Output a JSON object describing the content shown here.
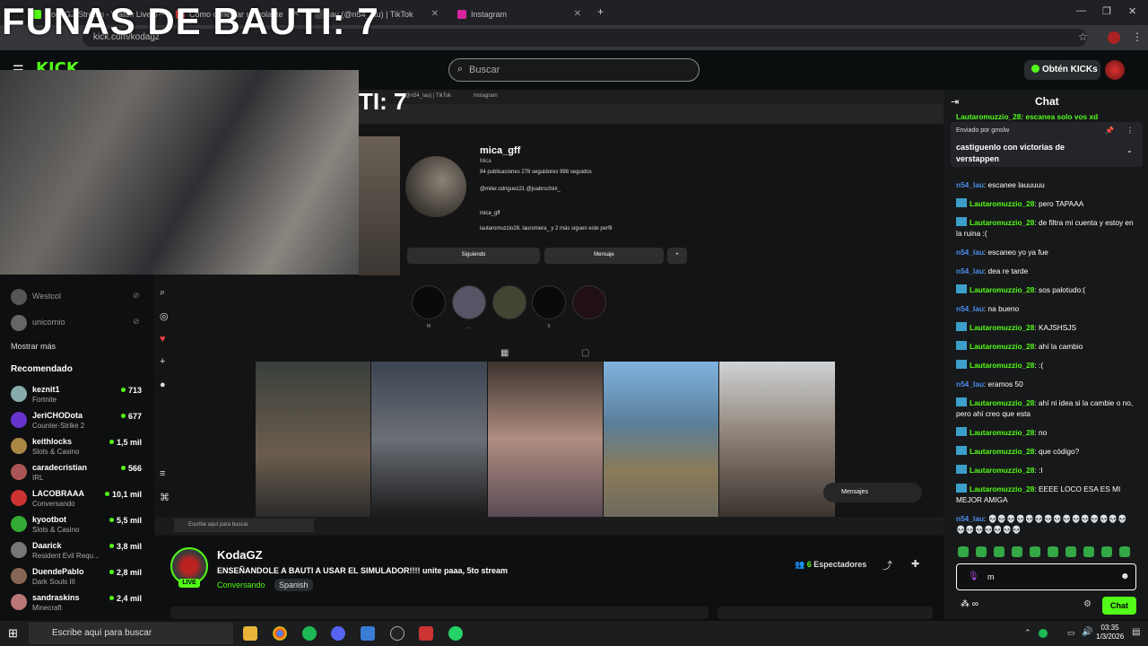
{
  "overlay": {
    "title": "FUNAS DE BAUTI: 7"
  },
  "browser": {
    "tabs": [
      {
        "label": "KodaGZ Stream - Watch Live o",
        "color": "#53fc18"
      },
      {
        "label": "Como conectar mi volante",
        "color": "#e33"
      },
      {
        "label": "lau (@n54_lau) | TikTok",
        "color": "#444"
      },
      {
        "label": "Instagram",
        "color": "#d6249f"
      }
    ],
    "new_tab": "+",
    "url": "kick.com/kodagz"
  },
  "header": {
    "logo": "KICK",
    "search_placeholder": "Buscar",
    "kicks_button": "Obtén KICKs"
  },
  "sidebar": {
    "followed": [
      {
        "name": "Westcol"
      },
      {
        "name": "unicornio"
      }
    ],
    "show_more": "Mostrar más",
    "recommended_heading": "Recomendado",
    "recommended": [
      {
        "name": "keznit1",
        "category": "Fortnite",
        "viewers": "713",
        "color": "#8aa"
      },
      {
        "name": "JeriCHODota",
        "category": "Counter-Strike 2",
        "viewers": "677",
        "color": "#63c"
      },
      {
        "name": "keithlocks",
        "category": "Slots & Casino",
        "viewers": "1,5 mil",
        "color": "#a84"
      },
      {
        "name": "caradecristian",
        "category": "IRL",
        "viewers": "566",
        "color": "#a55"
      },
      {
        "name": "LACOBRAAA",
        "category": "Conversando",
        "viewers": "10,1 mil",
        "color": "#c33"
      },
      {
        "name": "kyootbot",
        "category": "Slots & Casino",
        "viewers": "5,5 mil",
        "color": "#3a3"
      },
      {
        "name": "Daarick",
        "category": "Resident Evil Requ...",
        "viewers": "3,8 mil",
        "color": "#777"
      },
      {
        "name": "DuendePablo",
        "category": "Dark Souls III",
        "viewers": "2,8 mil",
        "color": "#865"
      },
      {
        "name": "sandraskins",
        "category": "Minecraft",
        "viewers": "2,4 mil",
        "color": "#b77"
      }
    ]
  },
  "screen": {
    "inner_title": "TI: 7",
    "inner_tabs": [
      "lau (@n54_lau) | TikTok",
      "Instagram"
    ],
    "profile": {
      "username": "mica_gff",
      "name": "Mica",
      "stats": "94 publicaciones   278 seguidores   998 seguidos",
      "bio1": "@miler.odriguez21   @juabrschini_",
      "bio2": "mica_gff",
      "followed_by": "lautaromuzzio28, lauromera_ y 2 más siguen este perfil",
      "following_button": "Siguiendo",
      "message_button": "Mensaje"
    },
    "story_labels": [
      "M",
      "_",
      "",
      "0",
      ""
    ],
    "messages_pill": "Mensajes",
    "taskbar_search": "Escribe aquí para buscar"
  },
  "stream": {
    "streamer": "KodaGZ",
    "live": "LIVE",
    "title": "ENSEÑANDOLE A BAUTI A USAR EL SIMULADOR!!!! unite paaa, 5to stream",
    "category": "Conversando",
    "language": "Spanish",
    "viewers_count": "6",
    "viewers_label": "Espectadores"
  },
  "chat": {
    "title": "Chat",
    "pinned_by": "Enviado por gmslw",
    "pinned_text": "castiguenlo con victorias de verstappen",
    "partial_top": "Lautaromuzzio_28: escanea solo vos xd",
    "messages": [
      {
        "user": "n54_lau",
        "text": "escanee lauuuuu"
      },
      {
        "user": "Lautaromuzzio_28",
        "text": "pero TAPAAA"
      },
      {
        "user": "Lautaromuzzio_28",
        "text": "de filtra mi cuenta y estoy en la ruina :("
      },
      {
        "user": "n54_lau",
        "text": "escaneo yo ya fue"
      },
      {
        "user": "n54_lau",
        "text": "dea re tarde"
      },
      {
        "user": "Lautaromuzzio_28",
        "text": "sos palotudo:("
      },
      {
        "user": "n54_lau",
        "text": "na bueno"
      },
      {
        "user": "Lautaromuzzio_28",
        "text": "KAJSHSJS"
      },
      {
        "user": "Lautaromuzzio_28",
        "text": "ahí la cambio"
      },
      {
        "user": "Lautaromuzzio_28",
        "text": ":("
      },
      {
        "user": "n54_lau",
        "text": "eramos 50"
      },
      {
        "user": "Lautaromuzzio_28",
        "text": "ahí ni idea si la cambie o no, pero ahí creo que esta"
      },
      {
        "user": "Lautaromuzzio_28",
        "text": "no"
      },
      {
        "user": "Lautaromuzzio_28",
        "text": "que código?"
      },
      {
        "user": "Lautaromuzzio_28",
        "text": ":I"
      },
      {
        "user": "Lautaromuzzio_28",
        "text": "EEEE LOCO ESA ES MI MEJOR AMIGA"
      },
      {
        "user": "n54_lau",
        "text": "💀💀💀💀💀💀💀💀💀💀💀💀💀💀💀💀💀💀💀💀💀💀"
      }
    ],
    "input_value": "m",
    "points": "∞",
    "send_button": "Chat"
  },
  "taskbar": {
    "search": "Escribe aquí para buscar",
    "time": "03:35",
    "date": "1/3/2026"
  }
}
